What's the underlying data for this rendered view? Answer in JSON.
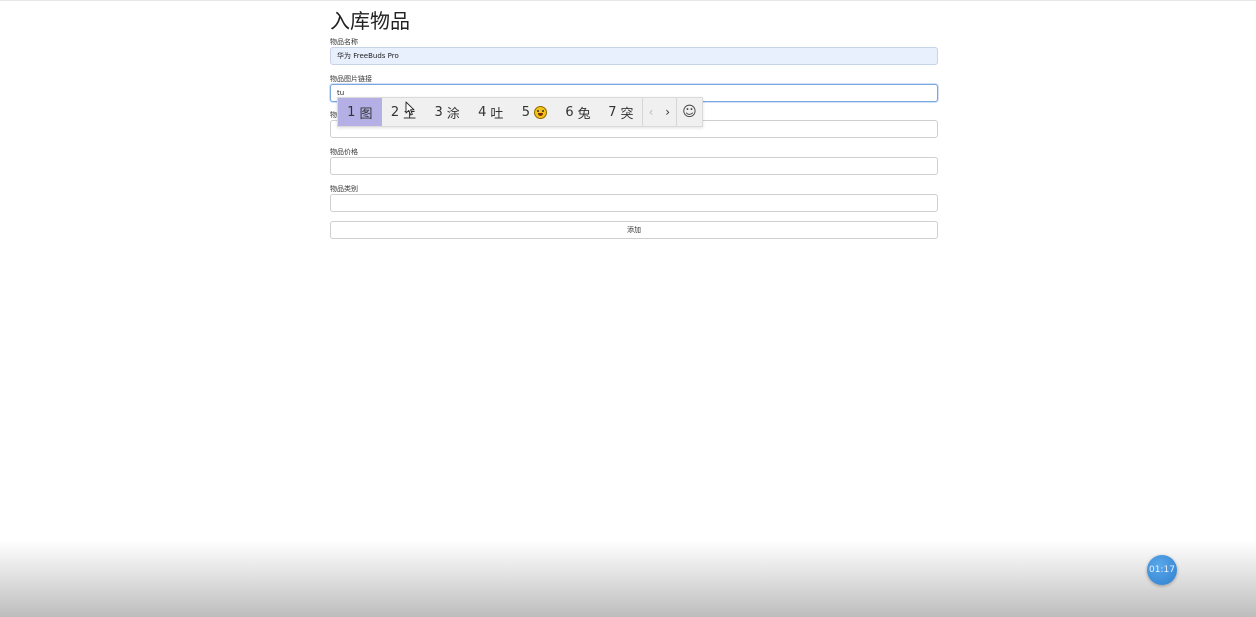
{
  "form": {
    "title": "入库物品",
    "fields": [
      {
        "label": "物品名称",
        "value": "华为 FreeBuds Pro",
        "placeholder": ""
      },
      {
        "label": "物品图片链接",
        "value": "tu",
        "placeholder": ""
      },
      {
        "label": "物",
        "value": "",
        "placeholder": ""
      },
      {
        "label": "物品价格",
        "value": "",
        "placeholder": ""
      },
      {
        "label": "物品类别",
        "value": "",
        "placeholder": ""
      }
    ],
    "submit_label": "添加"
  },
  "ime": {
    "candidates": [
      {
        "num": "1",
        "text": "图"
      },
      {
        "num": "2",
        "text": "土"
      },
      {
        "num": "3",
        "text": "涂"
      },
      {
        "num": "4",
        "text": "吐"
      },
      {
        "num": "5",
        "text": ""
      },
      {
        "num": "6",
        "text": "兔"
      },
      {
        "num": "7",
        "text": "突"
      }
    ],
    "prev_glyph": "‹",
    "next_glyph": "›",
    "emoji_glyph": "☺",
    "selected_index": 0,
    "candidate5_icon": "grinning-emoji-icon"
  },
  "timer": {
    "text": "01:17",
    "color": "#3a8ad8"
  }
}
